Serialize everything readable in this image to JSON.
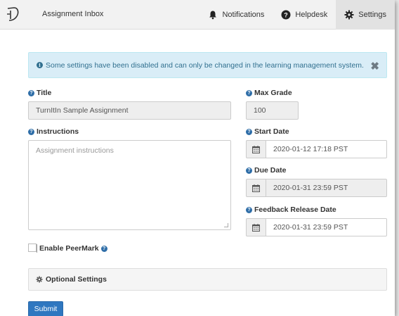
{
  "header": {
    "app_title": "Assignment Inbox",
    "nav": {
      "notifications": "Notifications",
      "helpdesk": "Helpdesk",
      "settings": "Settings"
    }
  },
  "alert": {
    "message": "Some settings have been disabled and can only be changed in the learning management system.",
    "close": "✖"
  },
  "form": {
    "title": {
      "label": "Title",
      "value": "TurnItIn Sample Assignment"
    },
    "max_grade": {
      "label": "Max Grade",
      "value": "100"
    },
    "instructions": {
      "label": "Instructions",
      "placeholder": "Assignment instructions"
    },
    "start_date": {
      "label": "Start Date",
      "value": "2020-01-12 17:18 PST"
    },
    "due_date": {
      "label": "Due Date",
      "value": "2020-01-31 23:59 PST"
    },
    "feedback_release_date": {
      "label": "Feedback Release Date",
      "value": "2020-01-31 23:59 PST"
    },
    "peermark": {
      "label": "Enable PeerMark"
    },
    "optional_settings": {
      "label": "Optional Settings"
    },
    "submit": "Submit"
  },
  "icons": {
    "logo": "turnitin-logo-icon",
    "notifications": "bell-icon",
    "helpdesk": "question-circle-icon",
    "settings": "gear-icon",
    "calendar": "calendar-icon"
  },
  "colors": {
    "accent": "#2f77c0",
    "alert_bg": "#d9edf7",
    "alert_text": "#31708f",
    "navbar_bg": "#f2f2f2"
  }
}
